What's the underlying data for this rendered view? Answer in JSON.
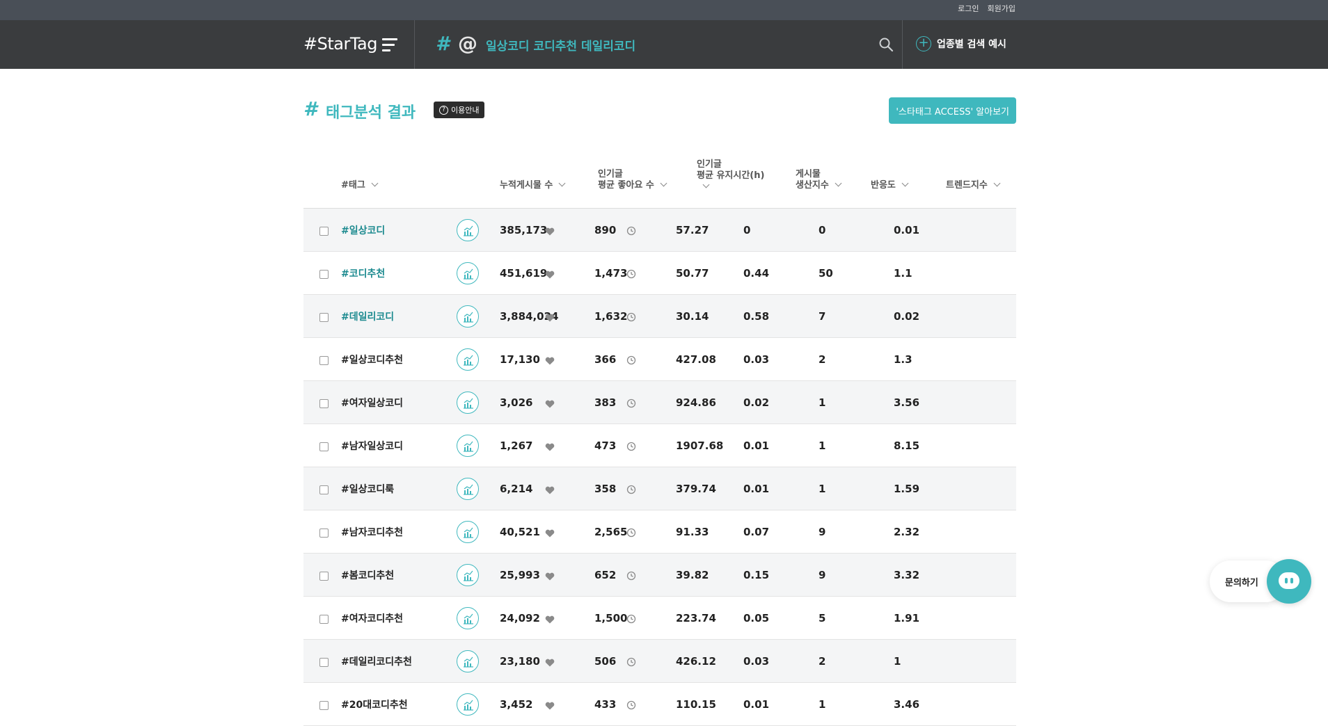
{
  "topbar": {
    "login": "로그인",
    "signup": "회원가입"
  },
  "header": {
    "logo": "#StarTag",
    "search_hash": "#",
    "search_at": "@",
    "search_value": "일상코디 코디추천 데일리코디",
    "biz_search_label": "업종별 검색 예시"
  },
  "page": {
    "title_hash": "#",
    "title": "태그분석 결과",
    "guide_label": "이용안내",
    "access_button": "'스타태그 ACCESS' 알아보기"
  },
  "table": {
    "headers": {
      "tag": "#태그",
      "posts": "누적게시물 수",
      "likes_1": "인기글",
      "likes_2": "평균 좋아요 수",
      "hold_1": "인기글",
      "hold_2": "평균 유지시간(h)",
      "prod_1": "게시물",
      "prod_2": "생산지수",
      "react": "반응도",
      "trend": "트렌드지수"
    },
    "rows": [
      {
        "tag": "#일상코디",
        "posts": "385,173",
        "likes": "890",
        "hold": "57.27",
        "prod": "0",
        "react": "0",
        "trend": "0.01",
        "hl": true
      },
      {
        "tag": "#코디추천",
        "posts": "451,619",
        "likes": "1,473",
        "hold": "50.77",
        "prod": "0.44",
        "react": "50",
        "trend": "1.1",
        "hl": true
      },
      {
        "tag": "#데일리코디",
        "posts": "3,884,024",
        "likes": "1,632",
        "hold": "30.14",
        "prod": "0.58",
        "react": "7",
        "trend": "0.02",
        "hl": true
      },
      {
        "tag": "#일상코디추천",
        "posts": "17,130",
        "likes": "366",
        "hold": "427.08",
        "prod": "0.03",
        "react": "2",
        "trend": "1.3",
        "hl": false
      },
      {
        "tag": "#여자일상코디",
        "posts": "3,026",
        "likes": "383",
        "hold": "924.86",
        "prod": "0.02",
        "react": "1",
        "trend": "3.56",
        "hl": false
      },
      {
        "tag": "#남자일상코디",
        "posts": "1,267",
        "likes": "473",
        "hold": "1907.68",
        "prod": "0.01",
        "react": "1",
        "trend": "8.15",
        "hl": false
      },
      {
        "tag": "#일상코디룩",
        "posts": "6,214",
        "likes": "358",
        "hold": "379.74",
        "prod": "0.01",
        "react": "1",
        "trend": "1.59",
        "hl": false
      },
      {
        "tag": "#남자코디추천",
        "posts": "40,521",
        "likes": "2,565",
        "hold": "91.33",
        "prod": "0.07",
        "react": "9",
        "trend": "2.32",
        "hl": false
      },
      {
        "tag": "#봄코디추천",
        "posts": "25,993",
        "likes": "652",
        "hold": "39.82",
        "prod": "0.15",
        "react": "9",
        "trend": "3.32",
        "hl": false
      },
      {
        "tag": "#여자코디추천",
        "posts": "24,092",
        "likes": "1,500",
        "hold": "223.74",
        "prod": "0.05",
        "react": "5",
        "trend": "1.91",
        "hl": false
      },
      {
        "tag": "#데일리코디추천",
        "posts": "23,180",
        "likes": "506",
        "hold": "426.12",
        "prod": "0.03",
        "react": "2",
        "trend": "1",
        "hl": false
      },
      {
        "tag": "#20대코디추천",
        "posts": "3,452",
        "likes": "433",
        "hold": "110.15",
        "prod": "0.01",
        "react": "1",
        "trend": "3.46",
        "hl": false
      }
    ]
  },
  "chat": {
    "label": "문의하기"
  },
  "colors": {
    "accent": "#3fb8be",
    "header_bg": "#3a3c3e",
    "topbar_bg": "#494f57",
    "tag_highlight": "#1c8a8f"
  }
}
